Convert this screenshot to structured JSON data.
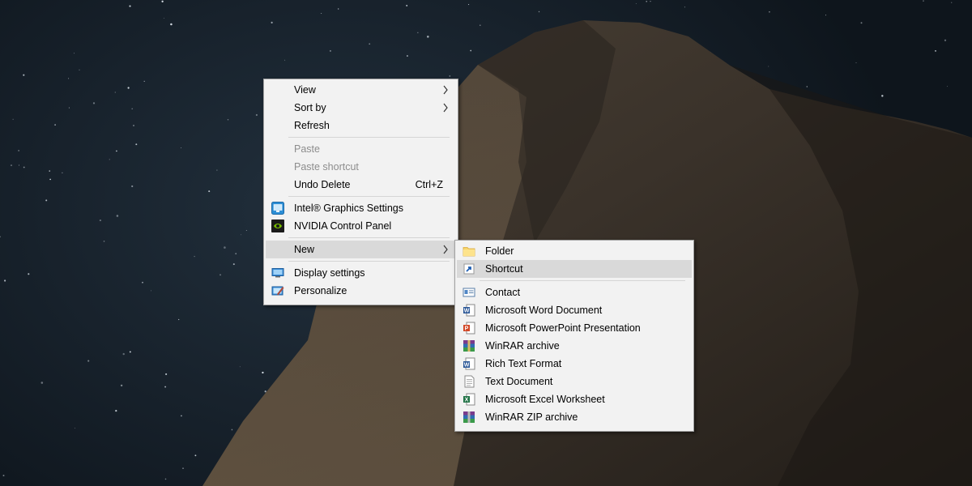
{
  "context_menu": {
    "items": [
      {
        "label": "View",
        "submenu": true
      },
      {
        "label": "Sort by",
        "submenu": true
      },
      {
        "label": "Refresh"
      },
      {
        "label": "Paste",
        "disabled": true
      },
      {
        "label": "Paste shortcut",
        "disabled": true
      },
      {
        "label": "Undo Delete",
        "shortcut": "Ctrl+Z"
      },
      {
        "label": "Intel® Graphics Settings",
        "icon": "intel-graphics-icon"
      },
      {
        "label": "NVIDIA Control Panel",
        "icon": "nvidia-icon"
      },
      {
        "label": "New",
        "submenu": true,
        "highlighted": true
      },
      {
        "label": "Display settings",
        "icon": "display-icon"
      },
      {
        "label": "Personalize",
        "icon": "personalize-icon"
      }
    ]
  },
  "new_submenu": {
    "items": [
      {
        "label": "Folder",
        "icon": "folder-icon"
      },
      {
        "label": "Shortcut",
        "icon": "shortcut-icon",
        "highlighted": true
      },
      {
        "label": "Contact",
        "icon": "contact-icon"
      },
      {
        "label": "Microsoft Word Document",
        "icon": "word-document-icon"
      },
      {
        "label": "Microsoft PowerPoint Presentation",
        "icon": "powerpoint-icon"
      },
      {
        "label": "WinRAR archive",
        "icon": "winrar-icon"
      },
      {
        "label": "Rich Text Format",
        "icon": "rich-text-icon"
      },
      {
        "label": "Text Document",
        "icon": "text-document-icon"
      },
      {
        "label": "Microsoft Excel Worksheet",
        "icon": "excel-icon"
      },
      {
        "label": "WinRAR ZIP archive",
        "icon": "winrar-zip-icon"
      }
    ]
  },
  "colors": {
    "menu_background": "#f2f2f2",
    "highlight": "#d9d9d9",
    "disabled_text": "#8d8d8d"
  }
}
